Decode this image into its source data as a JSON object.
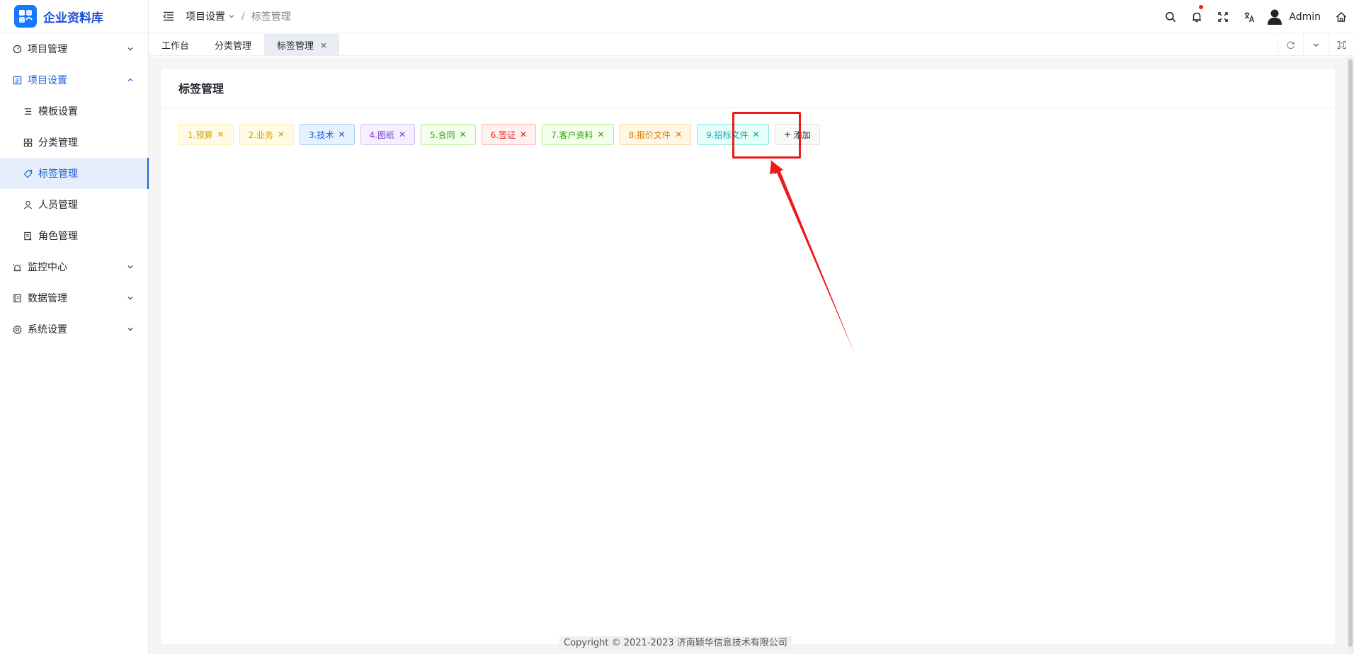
{
  "app": {
    "title": "企业资料库"
  },
  "sidebar": {
    "items": [
      {
        "label": "项目管理",
        "icon": "dashboard-icon",
        "open": false
      },
      {
        "label": "项目设置",
        "icon": "list-doc-icon",
        "open": true,
        "children": [
          {
            "label": "模板设置",
            "icon": "align-icon"
          },
          {
            "label": "分类管理",
            "icon": "grid-icon"
          },
          {
            "label": "标签管理",
            "icon": "tag-icon",
            "active": true
          },
          {
            "label": "人员管理",
            "icon": "user-icon"
          },
          {
            "label": "角色管理",
            "icon": "role-doc-icon"
          }
        ]
      },
      {
        "label": "监控中心",
        "icon": "alarm-icon",
        "open": false
      },
      {
        "label": "数据管理",
        "icon": "book-icon",
        "open": false
      },
      {
        "label": "系统设置",
        "icon": "gear-icon",
        "open": false
      }
    ]
  },
  "header": {
    "breadcrumb": {
      "parent": "项目设置",
      "separator": "/",
      "current": "标签管理"
    },
    "user": {
      "name": "Admin"
    }
  },
  "tabs": [
    {
      "label": "工作台"
    },
    {
      "label": "分类管理"
    },
    {
      "label": "标签管理",
      "active": true,
      "closable": true
    }
  ],
  "card": {
    "title": "标签管理"
  },
  "tags": [
    {
      "label": "1.预算",
      "color": "#d4a106",
      "bg": "#fffbe6",
      "border": "#fff1a8"
    },
    {
      "label": "2.业务",
      "color": "#d4a106",
      "bg": "#fffbe6",
      "border": "#fff1a8"
    },
    {
      "label": "3.技术",
      "color": "#1a5fd6",
      "bg": "#e6f1ff",
      "border": "#a9ccf5"
    },
    {
      "label": "4.图纸",
      "color": "#7b3fd1",
      "bg": "#f6efff",
      "border": "#d6bff5"
    },
    {
      "label": "5.合同",
      "color": "#389e0d",
      "bg": "#f4ffed",
      "border": "#b7eb8f"
    },
    {
      "label": "6.签证",
      "color": "#e02020",
      "bg": "#fff1f0",
      "border": "#ffb3b0"
    },
    {
      "label": "7.客户资料",
      "color": "#389e0d",
      "bg": "#f4ffed",
      "border": "#b7eb8f"
    },
    {
      "label": "8.报价文件",
      "color": "#e07b00",
      "bg": "#fff7e6",
      "border": "#ffd591"
    },
    {
      "label": "9.招标文件",
      "color": "#13a8a8",
      "bg": "#e6fffb",
      "border": "#87e8de"
    }
  ],
  "add_button": {
    "label": "添加"
  },
  "footer": {
    "text": "Copyright © 2021-2023 济南颖华信息技术有限公司"
  },
  "colors": {
    "accent": "#1a5fd6",
    "annotation": "#f01818"
  }
}
